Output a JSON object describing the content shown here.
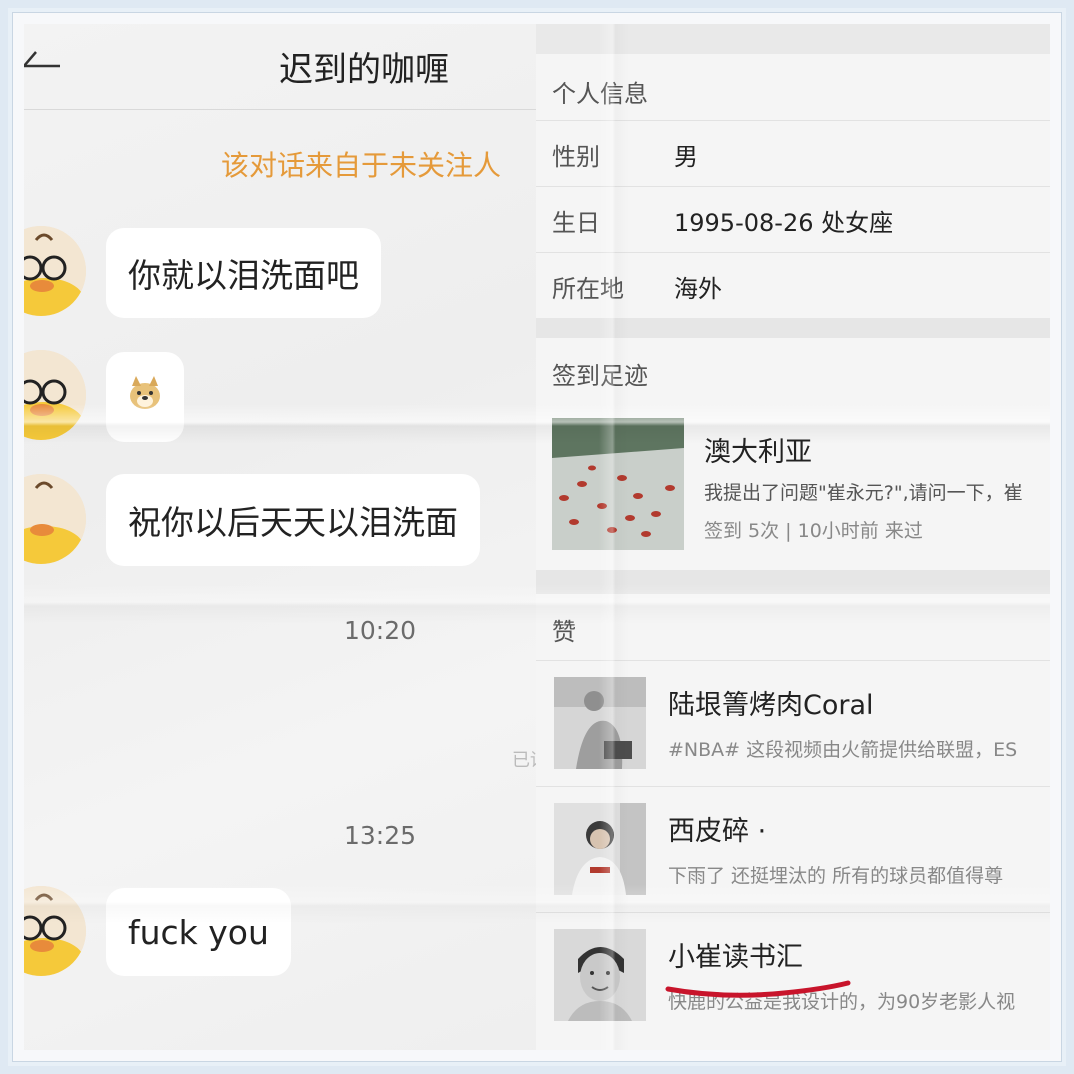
{
  "chat": {
    "title": "迟到的咖喱",
    "notice": "该对话来自于未关注人",
    "messages": [
      {
        "text": "你就以泪洗面吧"
      },
      {
        "text": "🐶"
      },
      {
        "text": "祝你以后天天以泪洗面"
      },
      {
        "text": "fuck you"
      }
    ],
    "timestamps": [
      "10:20",
      "13:25"
    ],
    "faint_status": "已读"
  },
  "profile": {
    "info_title": "个人信息",
    "rows": [
      {
        "label": "性别",
        "value": "男"
      },
      {
        "label": "生日",
        "value": "1995-08-26  处女座"
      },
      {
        "label": "所在地",
        "value": "海外"
      }
    ],
    "checkin": {
      "title": "签到足迹",
      "place": "澳大利亚",
      "desc": "我提出了问题\"崔永元?\",请问一下，崔",
      "meta": "签到 5次 | 10小时前 来过"
    },
    "likes": {
      "title": "赞",
      "items": [
        {
          "name": "陆垠箐烤肉Coral",
          "desc": "#NBA# 这段视频由火箭提供给联盟，ES"
        },
        {
          "name": "西皮碎 ·",
          "desc": "下雨了 还挺埋汰的 所有的球员都值得尊"
        },
        {
          "name": "小崔读书汇",
          "desc": "快鹿的公益是我设计的，为90岁老影人视"
        }
      ]
    },
    "colors": {
      "accent_orange": "#e59a3a",
      "underline_red": "#c8142b"
    }
  }
}
